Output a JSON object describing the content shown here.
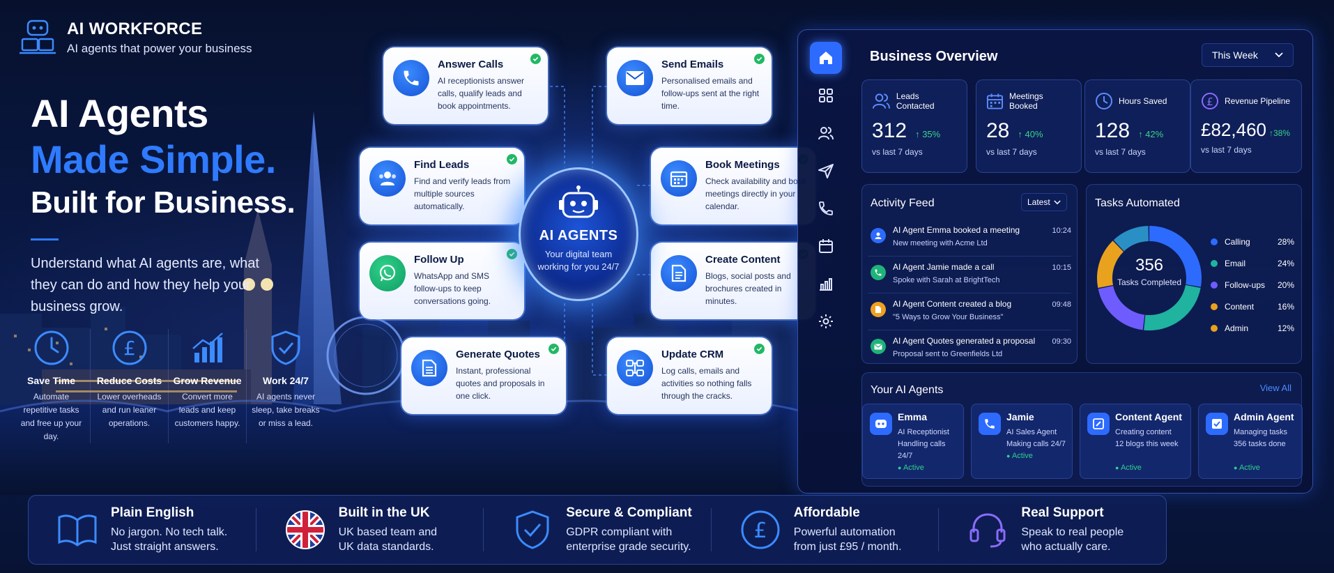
{
  "brand": {
    "title": "AI WORKFORCE",
    "subtitle": "AI agents that power your business"
  },
  "hero": {
    "line1": "AI Agents",
    "line2": "Made Simple.",
    "line3": "Built for Business.",
    "description": "Understand what AI agents are, what they can do and how they help your business grow."
  },
  "benefits": [
    {
      "title": "Save Time",
      "desc": "Automate repetitive tasks and free up your day."
    },
    {
      "title": "Reduce Costs",
      "desc": "Lower overheads and run leaner operations."
    },
    {
      "title": "Grow Revenue",
      "desc": "Convert more leads and keep customers happy."
    },
    {
      "title": "Work 24/7",
      "desc": "AI agents never sleep, take breaks or miss a lead."
    }
  ],
  "hub": {
    "title": "AI AGENTS",
    "subtitle": "Your digital team working for you 24/7"
  },
  "agent_cards": [
    {
      "title": "Answer Calls",
      "desc": "AI receptionists answer calls, qualify leads and book appointments."
    },
    {
      "title": "Send Emails",
      "desc": "Personalised emails and follow-ups sent at the right time."
    },
    {
      "title": "Find Leads",
      "desc": "Find and verify leads from multiple sources automatically."
    },
    {
      "title": "Book Meetings",
      "desc": "Check availability and book meetings directly in your calendar."
    },
    {
      "title": "Follow Up",
      "desc": "WhatsApp and SMS follow-ups to keep conversations going."
    },
    {
      "title": "Create Content",
      "desc": "Blogs, social posts and brochures created in minutes."
    },
    {
      "title": "Generate Quotes",
      "desc": "Instant, professional quotes and proposals in one click."
    },
    {
      "title": "Update CRM",
      "desc": "Log calls, emails and activities so nothing falls through the cracks."
    }
  ],
  "dashboard": {
    "title": "Business Overview",
    "period": "This Week",
    "stats": [
      {
        "label": "Leads Contacted",
        "value": "312",
        "change": "35%",
        "footer": "vs last 7 days"
      },
      {
        "label": "Meetings Booked",
        "value": "28",
        "change": "40%",
        "footer": "vs last 7 days"
      },
      {
        "label": "Hours Saved",
        "value": "128",
        "change": "42%",
        "footer": "vs last 7 days"
      },
      {
        "label": "Revenue Pipeline",
        "value": "£82,460",
        "change": "38%",
        "footer": "vs last 7 days"
      }
    ],
    "activity": {
      "title": "Activity Feed",
      "filter": "Latest",
      "items": [
        {
          "title": "AI Agent Emma booked a meeting",
          "sub": "New meeting with Acme Ltd",
          "time": "10:24",
          "color": "#2d6bff"
        },
        {
          "title": "AI Agent Jamie made a call",
          "sub": "Spoke with Sarah at BrightTech",
          "time": "10:15",
          "color": "#1fb37a"
        },
        {
          "title": "AI Agent Content created a blog",
          "sub": "\"5 Ways to Grow Your Business\"",
          "time": "09:48",
          "color": "#f0a020"
        },
        {
          "title": "AI Agent Quotes generated a proposal",
          "sub": "Proposal sent to Greenfields Ltd",
          "time": "09:30",
          "color": "#1fb37a"
        }
      ]
    },
    "tasks": {
      "title": "Tasks Automated",
      "total": "356",
      "total_label": "Tasks Completed",
      "legend": [
        {
          "name": "Calling",
          "pct": "28%",
          "value": 28,
          "color": "#2d6bff"
        },
        {
          "name": "Email",
          "pct": "24%",
          "value": 24,
          "color": "#1fb3a0"
        },
        {
          "name": "Follow-ups",
          "pct": "20%",
          "value": 20,
          "color": "#6f5cff"
        },
        {
          "name": "Content",
          "pct": "16%",
          "value": 16,
          "color": "#e8a21e"
        },
        {
          "name": "Admin",
          "pct": "12%",
          "value": 12,
          "color": "#2a8fc4"
        }
      ]
    },
    "agents": {
      "title": "Your AI Agents",
      "view_all": "View All",
      "items": [
        {
          "name": "Emma",
          "role": "AI Receptionist",
          "task": "Handling calls 24/7",
          "status": "Active"
        },
        {
          "name": "Jamie",
          "role": "AI Sales Agent",
          "task": "Making calls 24/7",
          "status": "Active"
        },
        {
          "name": "Content Agent",
          "role": "Creating content",
          "task": "12 blogs this week",
          "status": "Active"
        },
        {
          "name": "Admin Agent",
          "role": "Managing tasks",
          "task": "356 tasks done",
          "status": "Active"
        }
      ]
    }
  },
  "features": [
    {
      "title": "Plain English",
      "desc1": "No jargon. No tech talk.",
      "desc2": "Just straight answers."
    },
    {
      "title": "Built in the UK",
      "desc1": "UK based team and",
      "desc2": "UK data standards."
    },
    {
      "title": "Secure & Compliant",
      "desc1": "GDPR compliant with",
      "desc2": "enterprise grade security."
    },
    {
      "title": "Affordable",
      "desc1": "Powerful automation",
      "desc2": "from just £95 / month."
    },
    {
      "title": "Real Support",
      "desc1": "Speak to real people",
      "desc2": "who actually care."
    }
  ]
}
